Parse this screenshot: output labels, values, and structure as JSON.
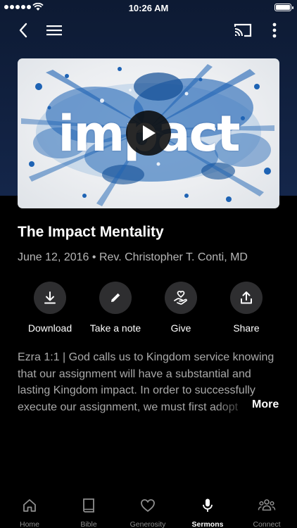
{
  "status_bar": {
    "time": "10:26 AM"
  },
  "nav": {
    "back_icon": "chevron-left-icon",
    "menu_icon": "hamburger-menu-icon",
    "cast_icon": "cast-icon",
    "more_icon": "more-vertical-icon"
  },
  "hero": {
    "artwork_text": "impact",
    "play_icon": "play-icon"
  },
  "sermon": {
    "title": "The Impact Mentality",
    "date": "June 12, 2016",
    "separator": "•",
    "speaker": "Rev. Christopher T. Conti, MD"
  },
  "actions": [
    {
      "label": "Download",
      "icon": "download-icon"
    },
    {
      "label": "Take a note",
      "icon": "pencil-icon"
    },
    {
      "label": "Give",
      "icon": "give-heart-hand-icon"
    },
    {
      "label": "Share",
      "icon": "share-icon"
    }
  ],
  "description": {
    "lines": [
      "Ezra 1:1 | God calls us to Kingdom service knowing",
      "that our assignment will have a substantial and",
      "lasting Kingdom impact.  In order to successfully",
      "execute our assignment, we must first adopt"
    ],
    "more_label": "More"
  },
  "tabs": [
    {
      "label": "Home",
      "icon": "home-icon",
      "active": false
    },
    {
      "label": "Bible",
      "icon": "book-icon",
      "active": false
    },
    {
      "label": "Generosity",
      "icon": "heart-icon",
      "active": false
    },
    {
      "label": "Sermons",
      "icon": "microphone-icon",
      "active": true
    },
    {
      "label": "Connect",
      "icon": "people-icon",
      "active": false
    }
  ],
  "colors": {
    "header_bg": "#14264a",
    "background": "#000000",
    "action_circle": "#2e2e30",
    "secondary_text": "#b6b6b6",
    "splash_blue": "#1e63b4"
  }
}
